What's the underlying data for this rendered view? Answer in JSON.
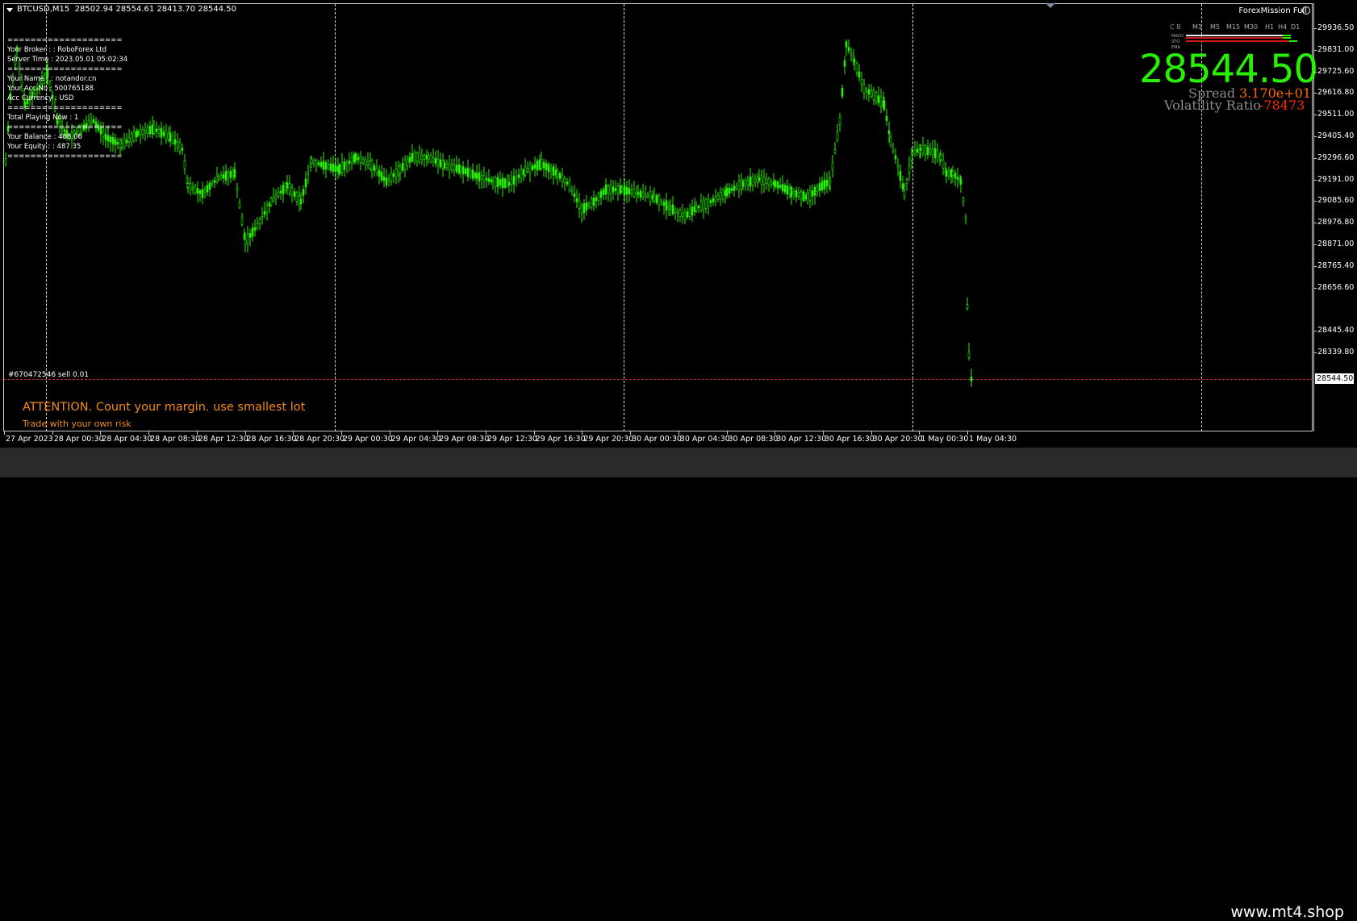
{
  "chart": {
    "symbol_header": "BTCUSD,M15  28502.94 28554.61 28413.70 28544.50",
    "indicator_name": "ForexMission Full",
    "current_price": "28544.50",
    "order_label": "#670472546 sell 0.01",
    "y_axis_labels": [
      "29936.50",
      "29831.00",
      "29725.60",
      "29616.80",
      "29511.00",
      "29405.40",
      "29296.60",
      "29191.00",
      "29085.60",
      "28976.80",
      "28871.00",
      "28765.40",
      "28656.60",
      "28544.50",
      "28445.40",
      "28339.80"
    ],
    "x_axis_labels": [
      "27 Apr 2023",
      "28 Apr 00:30",
      "28 Apr 04:30",
      "28 Apr 08:30",
      "28 Apr 12:30",
      "28 Apr 16:30",
      "28 Apr 20:30",
      "29 Apr 00:30",
      "29 Apr 04:30",
      "29 Apr 08:30",
      "29 Apr 12:30",
      "29 Apr 16:30",
      "29 Apr 20:30",
      "30 Apr 00:30",
      "30 Apr 04:30",
      "30 Apr 08:30",
      "30 Apr 12:30",
      "30 Apr 16:30",
      "30 Apr 20:30",
      "1 May 00:30",
      "1 May 04:30"
    ],
    "candle_color": "#27f000"
  },
  "info_panel": {
    "lines": [
      "====================",
      "Your Broker : : RoboForex Ltd",
      "Server Time : 2023.05.01 05:02:34",
      "====================",
      "Your Name : : notandor.cn",
      "Your Acc.No : 500765188",
      "Acc Currency : USD",
      "====================",
      "Total Playing Now : 1",
      "====================",
      "Your Balance : 488.06",
      "Your Equity : : 487.35",
      "===================="
    ]
  },
  "overlay": {
    "big_price": "28544.50",
    "spread_label": "Spread",
    "spread_value": "3.170e+01",
    "volatility_label": "Volatility Ratio",
    "volatility_value": "-78473",
    "timeframes": [
      "M1",
      "M5",
      "M15",
      "M30",
      "H1",
      "H4",
      "D1"
    ],
    "mini_rows": [
      "MACD",
      "STO",
      "EMA"
    ],
    "mini_prefix": "C B"
  },
  "messages": {
    "attention": "ATTENTION. Count your margin. use smallest lot",
    "risk": "Trade with your own risk"
  },
  "watermark": "www.mt4.shop",
  "colors": {
    "background": "#000000",
    "bull": "#27f000",
    "attention": "#f28b1c",
    "bid_line": "#c8202a"
  }
}
